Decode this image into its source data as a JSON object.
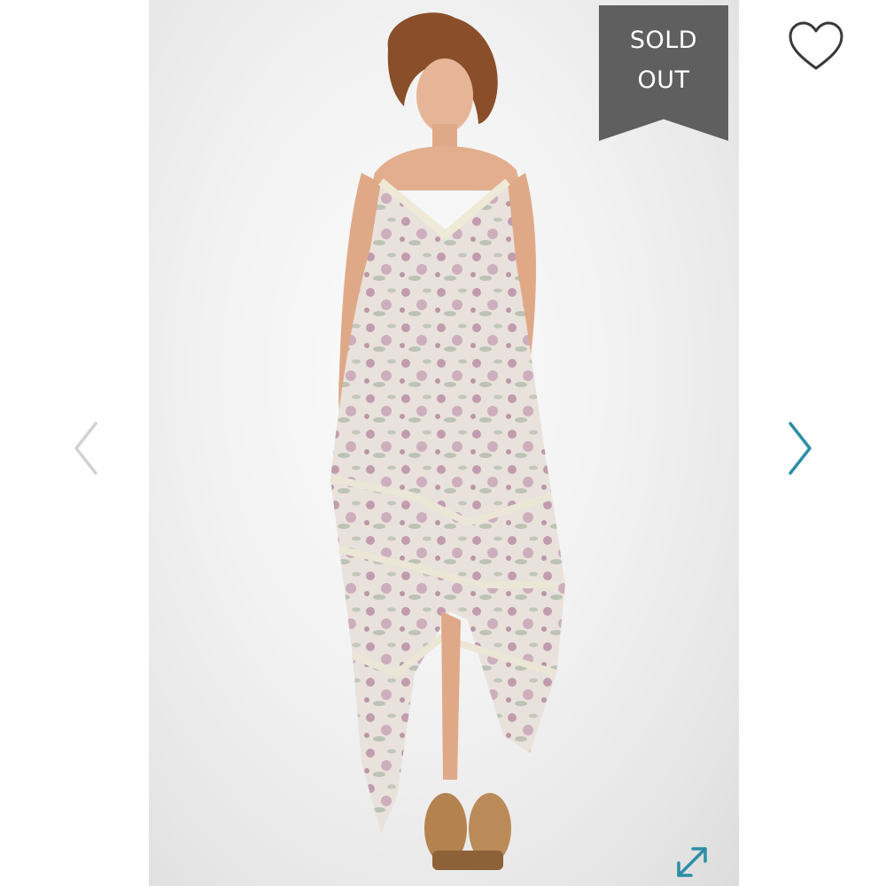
{
  "product_image": {
    "alt": "",
    "badge": {
      "line1": "SOLD",
      "line2": "OUT"
    }
  },
  "controls": {
    "favorite_icon": "heart-outline-icon",
    "prev_icon": "chevron-left-icon",
    "next_icon": "chevron-right-icon",
    "expand_icon": "expand-diagonal-icon"
  },
  "colors": {
    "badge_bg": "#5f5f5f",
    "accent": "#2a8fa6",
    "prev_arrow": "#cfd3d6",
    "heart_stroke": "#3a3a3a"
  }
}
